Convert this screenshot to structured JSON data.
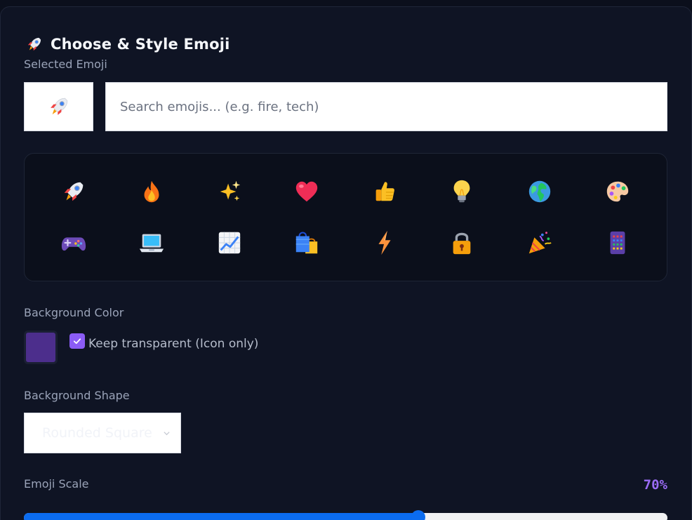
{
  "header": {
    "title": "Choose & Style Emoji",
    "icon": "rocket-icon"
  },
  "selected": {
    "label": "Selected Emoji",
    "emoji": "rocket"
  },
  "search": {
    "placeholder": "Search emojis... (e.g. fire, tech)",
    "value": ""
  },
  "emoji_grid": [
    "rocket",
    "fire",
    "sparkles",
    "red-heart",
    "thumbs-up",
    "light-bulb",
    "globe",
    "artist-palette",
    "video-game",
    "laptop",
    "chart-increasing",
    "shopping-bags",
    "high-voltage",
    "locked",
    "party-popper",
    "abacus"
  ],
  "background": {
    "label": "Background Color",
    "color": "#4c2e8c",
    "transparent_label": "Keep transparent (Icon only)",
    "transparent_checked": true
  },
  "shape": {
    "label": "Background Shape",
    "selected": "Rounded Square"
  },
  "scale": {
    "label": "Emoji Scale",
    "value_text": "70%",
    "fraction": 0.613
  },
  "colors": {
    "accent": "#8b5cf6",
    "slider": "#0b6cf0"
  }
}
